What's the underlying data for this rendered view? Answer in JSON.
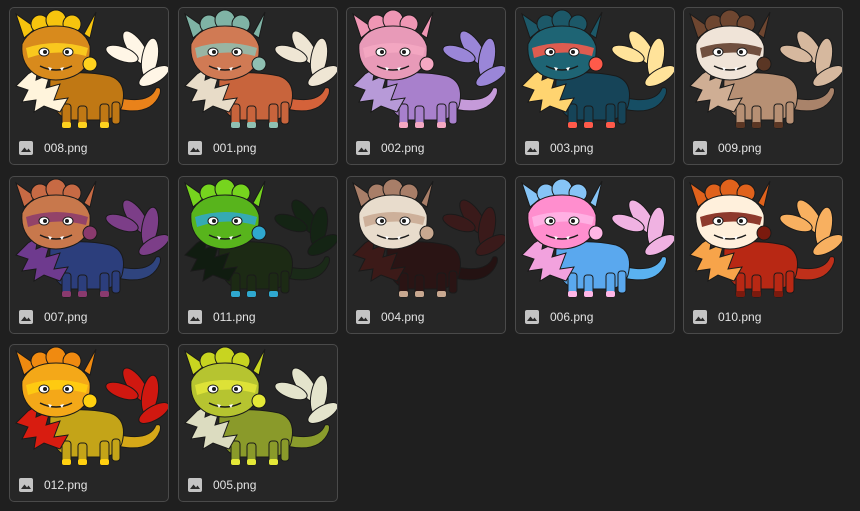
{
  "files": [
    {
      "name": "008.png",
      "icon": "image-icon",
      "palette": {
        "body": "#c07814",
        "fluff": "#fff4dc",
        "horn": "#f6c40e",
        "tail": "#e9821a",
        "tuft": "#fff6e6",
        "face": "#d88a1c",
        "accent": "#ffd21e"
      }
    },
    {
      "name": "001.png",
      "icon": "image-icon",
      "palette": {
        "body": "#c8643c",
        "fluff": "#e8dcc8",
        "horn": "#7fb3a5",
        "tail": "#d4623a",
        "tuft": "#efe6d4",
        "face": "#d07a54",
        "accent": "#8fc0b2"
      }
    },
    {
      "name": "002.png",
      "icon": "image-icon",
      "palette": {
        "body": "#a880cc",
        "fluff": "#b79ad8",
        "horn": "#ef96b4",
        "tail": "#c59ad9",
        "tuft": "#9a86d8",
        "face": "#e89ab8",
        "accent": "#f4a8c2"
      }
    },
    {
      "name": "003.png",
      "icon": "image-icon",
      "palette": {
        "body": "#164458",
        "fluff": "#ffd470",
        "horn": "#1c5868",
        "tail": "#164e64",
        "tuft": "#ffe39a",
        "face": "#1e6474",
        "accent": "#ff5a4a"
      }
    },
    {
      "name": "009.png",
      "icon": "image-icon",
      "palette": {
        "body": "#b79074",
        "fluff": "#cfae94",
        "horn": "#6e4630",
        "tail": "#a9836a",
        "tuft": "#d6b89e",
        "face": "#f0e4d8",
        "accent": "#5a3624"
      }
    },
    {
      "name": "007.png",
      "icon": "image-icon",
      "palette": {
        "body": "#2c3e7c",
        "fluff": "#6e3a8e",
        "horn": "#c76a44",
        "tail": "#2f447e",
        "tuft": "#7c3e88",
        "face": "#c8784c",
        "accent": "#8a3a6e"
      }
    },
    {
      "name": "011.png",
      "icon": "image-icon",
      "palette": {
        "body": "#1c2a14",
        "fluff": "#101c10",
        "horn": "#76d41e",
        "tail": "#1a2a18",
        "tuft": "#142414",
        "face": "#58b41c",
        "accent": "#2fa8cf"
      }
    },
    {
      "name": "004.png",
      "icon": "image-icon",
      "palette": {
        "body": "#2a1414",
        "fluff": "#3c1a18",
        "horn": "#a87e68",
        "tail": "#241212",
        "tuft": "#3a1a1a",
        "face": "#e8dccc",
        "accent": "#c8a890"
      }
    },
    {
      "name": "006.png",
      "icon": "image-icon",
      "palette": {
        "body": "#5aa8ee",
        "fluff": "#f2a2de",
        "horn": "#86c4f6",
        "tail": "#5ab2f0",
        "tuft": "#f0b2e2",
        "face": "#ff8ece",
        "accent": "#ffb6e6"
      }
    },
    {
      "name": "010.png",
      "icon": "image-icon",
      "palette": {
        "body": "#b82814",
        "fluff": "#f7a44a",
        "horn": "#e0621c",
        "tail": "#c0301a",
        "tuft": "#f8b060",
        "face": "#fff0dc",
        "accent": "#7a1a0e"
      }
    },
    {
      "name": "012.png",
      "icon": "image-icon",
      "palette": {
        "body": "#c4a418",
        "fluff": "#d81c10",
        "horn": "#f08a10",
        "tail": "#d6a818",
        "tuft": "#d01810",
        "face": "#f4a818",
        "accent": "#ffd010"
      }
    },
    {
      "name": "005.png",
      "icon": "image-icon",
      "palette": {
        "body": "#8a9a2a",
        "fluff": "#dcdcc0",
        "horn": "#c8d420",
        "tail": "#8a9c2c",
        "tuft": "#e4e4cc",
        "face": "#b6c430",
        "accent": "#e4e838"
      }
    }
  ]
}
